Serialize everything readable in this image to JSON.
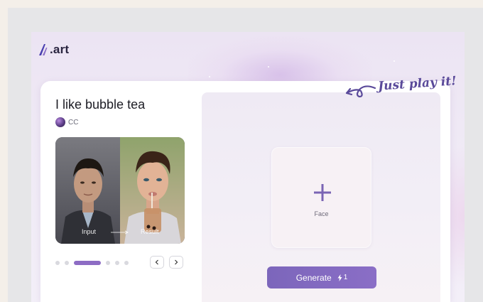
{
  "app": {
    "logo_text": ".art",
    "logo_icon": "stylized-A-logo-icon"
  },
  "tagline": "Just play it!",
  "template": {
    "title": "I like bubble tea",
    "author": "CC",
    "preview": {
      "input_label": "Input",
      "result_label": "Result"
    },
    "pagination": {
      "total": 6,
      "active_index": 2
    },
    "prev_icon": "chevron-left-icon",
    "next_icon": "chevron-right-icon"
  },
  "upload": {
    "label": "Face",
    "icon": "plus-icon"
  },
  "generate": {
    "label": "Generate",
    "cost": "1",
    "cost_icon": "bolt-icon"
  },
  "colors": {
    "accent": "#8a6ec6",
    "button": "#7c66bb",
    "tagline": "#5a4a9a"
  }
}
